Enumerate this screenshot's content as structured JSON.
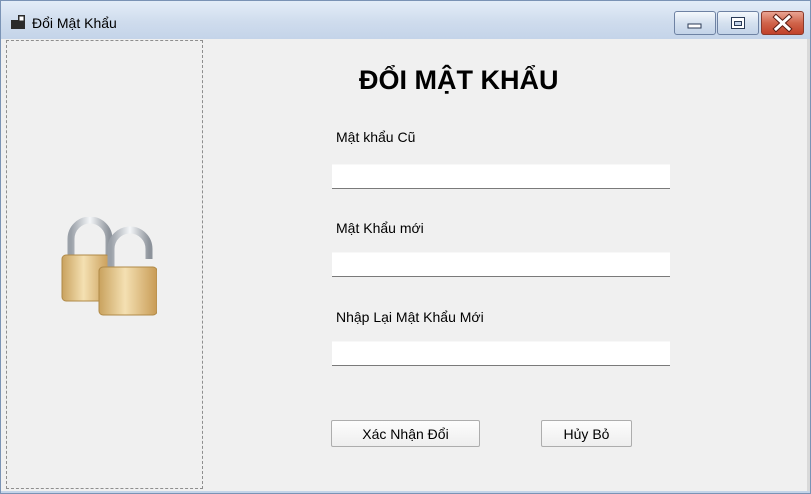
{
  "window": {
    "title": "Đổi Mật Khẩu",
    "icon": "app-window-icon",
    "controls": [
      "minimize-icon",
      "maximize-icon",
      "close-icon"
    ]
  },
  "side_panel": {
    "image": "padlocks-icon"
  },
  "form": {
    "title": "ĐỔI MẬT KHẨU",
    "old_password_label": "Mật khẩu Cũ",
    "old_password_value": "",
    "new_password_label": "Mật Khẩu mới",
    "new_password_value": "",
    "confirm_password_label": "Nhập Lại Mật Khẩu Mới",
    "confirm_password_value": ""
  },
  "buttons": {
    "confirm_label": "Xác Nhận Đổi",
    "cancel_label": "Hủy Bỏ"
  },
  "colors": {
    "titlebar": "#cfdced",
    "close_button": "#c1412a",
    "background": "#f0f0f0"
  }
}
